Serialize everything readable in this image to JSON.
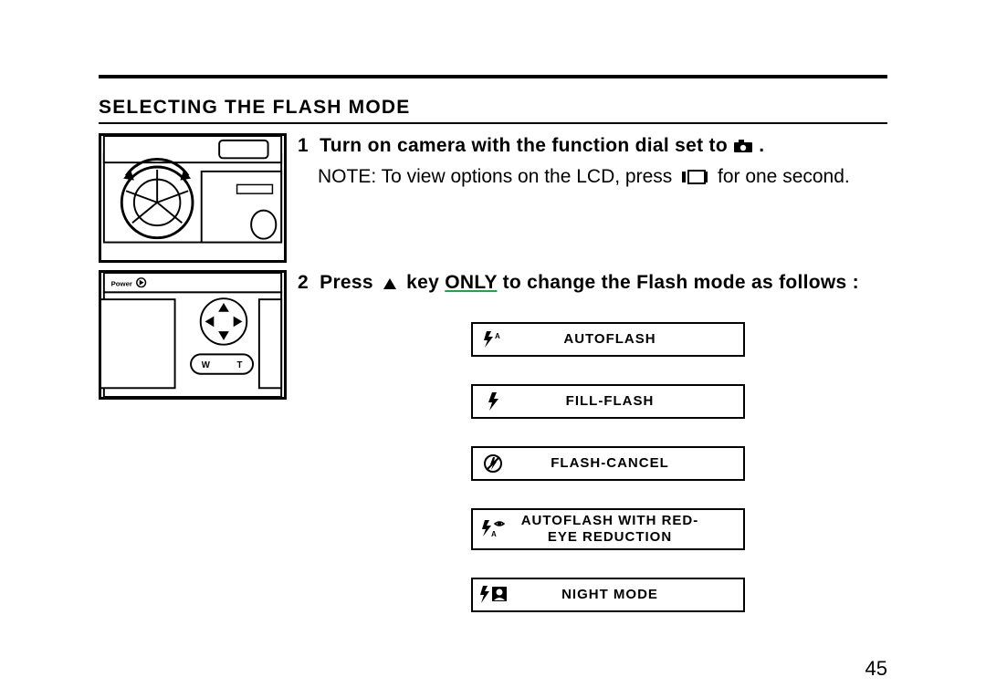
{
  "section_title": "SELECTING THE FLASH MODE",
  "step1": {
    "num": "1",
    "text_a": "Turn on camera with the function dial set to",
    "text_b": "."
  },
  "note": {
    "a": "NOTE: To view options on the LCD, press",
    "b": "for one second."
  },
  "step2": {
    "num": "2",
    "text_a": "Press",
    "text_b": "key",
    "text_only": "ONLY",
    "text_c": "to change the Flash mode as follows :"
  },
  "modes": [
    {
      "label": "AUTOFLASH"
    },
    {
      "label": "FILL-FLASH"
    },
    {
      "label": "FLASH-CANCEL"
    },
    {
      "label": "AUTOFLASH WITH RED-EYE REDUCTION"
    },
    {
      "label": "NIGHT MODE"
    }
  ],
  "page_number": "45"
}
